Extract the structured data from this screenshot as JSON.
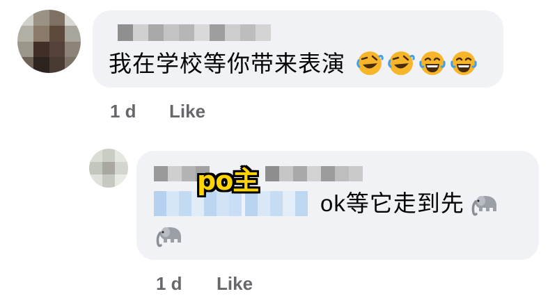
{
  "comments": [
    {
      "text": "我在学校等你带来表演",
      "emojis": [
        "rolling-laughing-emoji",
        "rolling-laughing-emoji",
        "tears-of-joy-emoji",
        "tears-of-joy-emoji"
      ],
      "meta": {
        "time": "1 d",
        "like_label": "Like"
      }
    },
    {
      "tag": "po主",
      "text": "ok等它走到先",
      "emojis": [
        "elephant-emoji",
        "elephant-emoji"
      ],
      "meta": {
        "time": "1 d",
        "like_label": "Like"
      }
    }
  ],
  "colors": {
    "bubble": "#f0f2f5",
    "meta_text": "#65676b",
    "tag_fill": "#ffd400",
    "blur_name": "#c8c8c8",
    "blur_text": "#bcd8f2"
  }
}
